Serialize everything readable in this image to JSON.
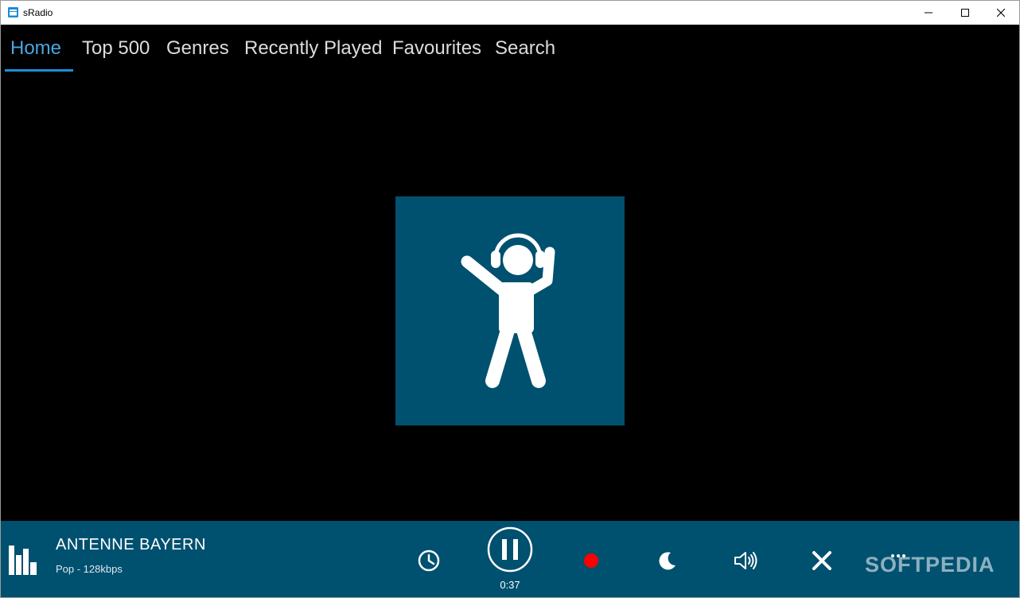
{
  "window": {
    "title": "sRadio"
  },
  "nav": {
    "tabs": [
      {
        "label": "Home"
      },
      {
        "label": "Top 500"
      },
      {
        "label": "Genres"
      },
      {
        "label": "Recently Played"
      },
      {
        "label": "Favourites"
      },
      {
        "label": "Search"
      }
    ],
    "active_tab": "Home"
  },
  "artwork": {
    "icon": "dancing-person-headphones-icon",
    "background": "#00506f"
  },
  "player": {
    "station_name": "ANTENNE BAYERN",
    "station_info": "Pop - 128kbps",
    "elapsed": "0:37",
    "state": "playing",
    "controls": [
      "history-icon",
      "pause-icon",
      "record-icon",
      "sleep-timer-icon",
      "volume-icon",
      "close-icon",
      "more-icon"
    ],
    "record_color": "#ff0000"
  },
  "watermark": {
    "text": "SOFTPEDIA"
  },
  "colors": {
    "accent": "#1d8fd6",
    "player_bar": "#00506f",
    "background": "#000000"
  }
}
